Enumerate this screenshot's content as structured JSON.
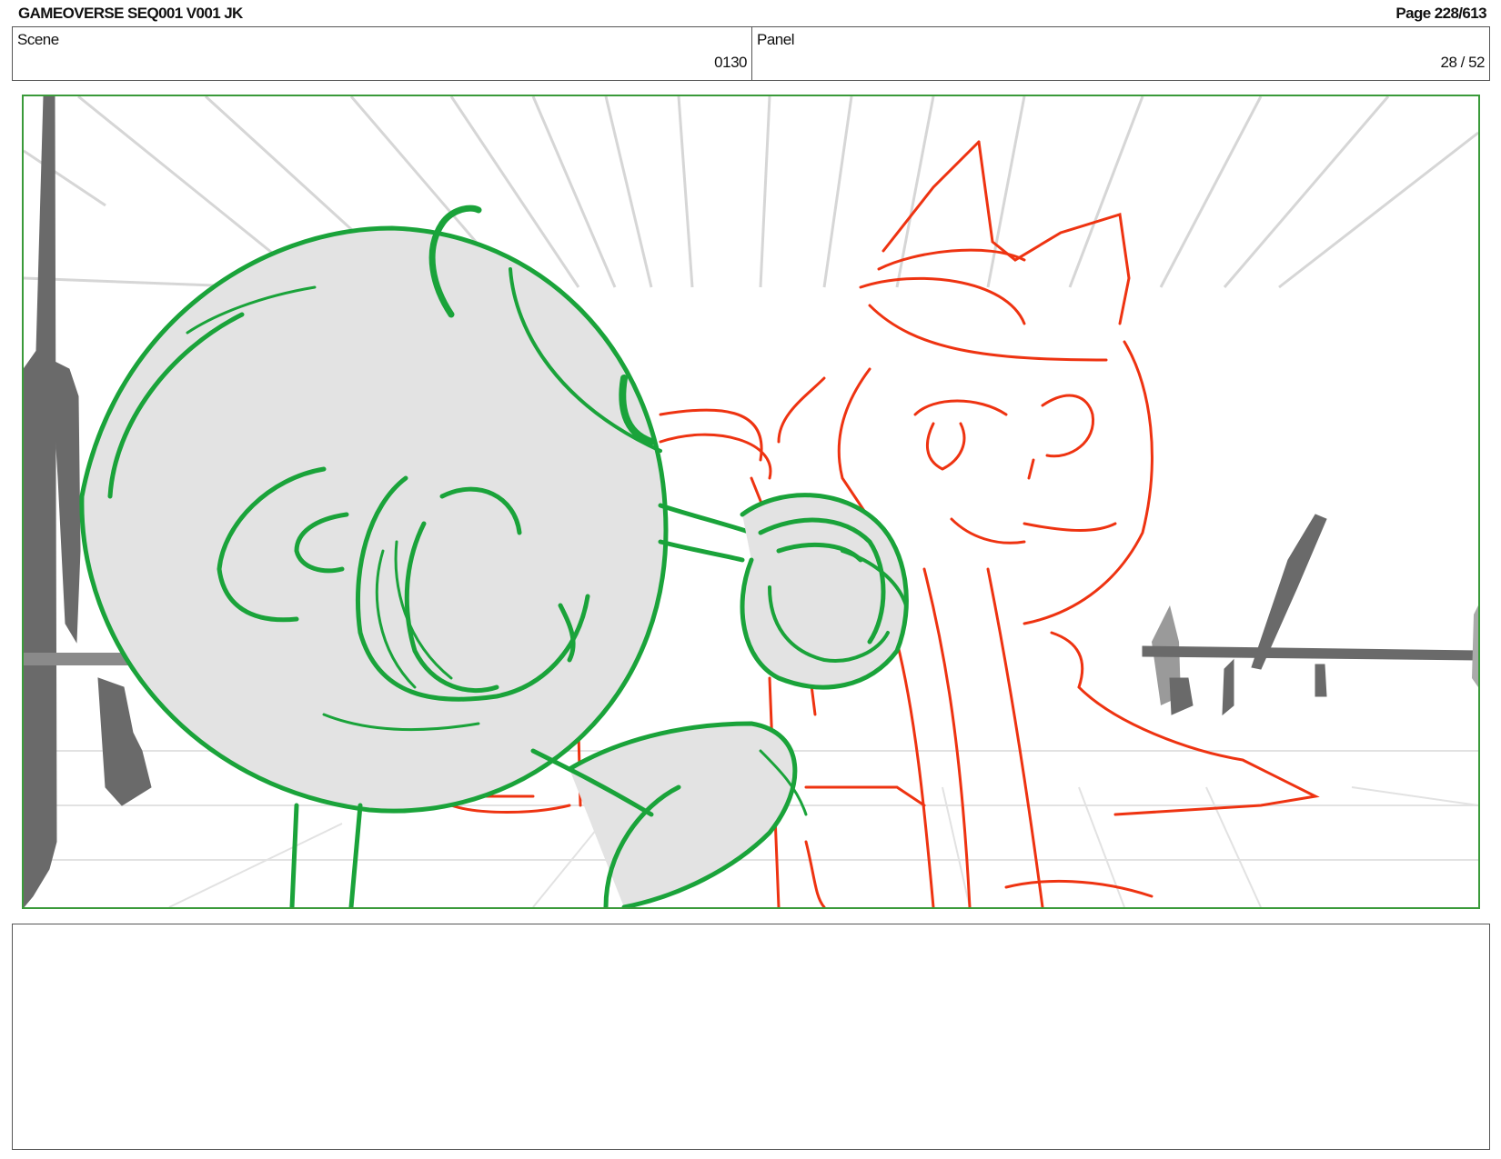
{
  "header": {
    "title": "GAMEOVERSE SEQ001 V001 JK",
    "page": "Page 228/613"
  },
  "info": {
    "scene_label": "Scene",
    "scene_value": "0130",
    "panel_label": "Panel",
    "panel_value": "28 / 52"
  },
  "panel_drawing": {
    "description_icon": "storyboard-sketch",
    "colors": {
      "frame": "#3a9a3a",
      "green_character": "#1aa33a",
      "red_character": "#ee3311",
      "background_gray": "#6a6a6a",
      "fill_gray": "#e3e3e3"
    }
  },
  "notes": {
    "text": ""
  }
}
